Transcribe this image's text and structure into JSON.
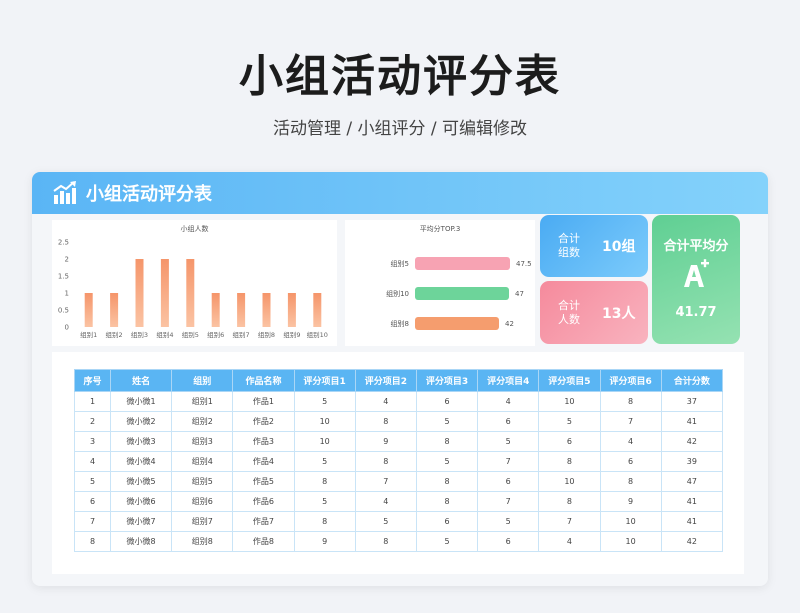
{
  "page": {
    "title": "小组活动评分表",
    "subtitle": "活动管理 / 小组评分 / 可编辑修改"
  },
  "card": {
    "title": "小组活动评分表",
    "icon": "bar-chart-growth-icon"
  },
  "stats": {
    "groups_label": "合计组数",
    "groups_value": "10组",
    "people_label": "合计人数",
    "people_value": "13人",
    "avg_label": "合计平均分",
    "avg_icon": "grade-a-plus-icon",
    "avg_value": "41.77"
  },
  "colors": {
    "header": "#5ab5f5",
    "bar": "#f39c72",
    "groups_card": "#4aabf3",
    "people_card": "#f58a9c",
    "avg_card": "#5fcf93"
  },
  "chart_data": [
    {
      "type": "bar",
      "title": "小组人数",
      "categories": [
        "组别1",
        "组别2",
        "组别3",
        "组别4",
        "组别5",
        "组别6",
        "组别7",
        "组别8",
        "组别9",
        "组别10"
      ],
      "values": [
        1,
        1,
        2,
        2,
        2,
        1,
        1,
        1,
        1,
        1
      ],
      "yticks": [
        "0",
        "0.5",
        "1",
        "1.5",
        "2",
        "2.5"
      ],
      "ylim": [
        0,
        2.5
      ],
      "grid": false
    },
    {
      "type": "bar",
      "orientation": "horizontal",
      "title": "平均分TOP.3",
      "categories": [
        "组别5",
        "组别10",
        "组别8"
      ],
      "values": [
        47.5,
        47,
        42
      ],
      "value_labels": [
        "47.5",
        "47",
        "42"
      ],
      "colors": [
        "#f7a3b3",
        "#6dd49a",
        "#f59d6e"
      ],
      "xlim": [
        0,
        50
      ]
    }
  ],
  "table": {
    "headers": [
      "序号",
      "姓名",
      "组别",
      "作品名称",
      "评分项目1",
      "评分项目2",
      "评分项目3",
      "评分项目4",
      "评分项目5",
      "评分项目6",
      "合计分数"
    ],
    "rows": [
      [
        "1",
        "微小微1",
        "组别1",
        "作品1",
        "5",
        "4",
        "6",
        "4",
        "10",
        "8",
        "37"
      ],
      [
        "2",
        "微小微2",
        "组别2",
        "作品2",
        "10",
        "8",
        "5",
        "6",
        "5",
        "7",
        "41"
      ],
      [
        "3",
        "微小微3",
        "组别3",
        "作品3",
        "10",
        "9",
        "8",
        "5",
        "6",
        "4",
        "42"
      ],
      [
        "4",
        "微小微4",
        "组别4",
        "作品4",
        "5",
        "8",
        "5",
        "7",
        "8",
        "6",
        "39"
      ],
      [
        "5",
        "微小微5",
        "组别5",
        "作品5",
        "8",
        "7",
        "8",
        "6",
        "10",
        "8",
        "47"
      ],
      [
        "6",
        "微小微6",
        "组别6",
        "作品6",
        "5",
        "4",
        "8",
        "7",
        "8",
        "9",
        "41"
      ],
      [
        "7",
        "微小微7",
        "组别7",
        "作品7",
        "8",
        "5",
        "6",
        "5",
        "7",
        "10",
        "41"
      ],
      [
        "8",
        "微小微8",
        "组别8",
        "作品8",
        "9",
        "8",
        "5",
        "6",
        "4",
        "10",
        "42"
      ]
    ]
  }
}
